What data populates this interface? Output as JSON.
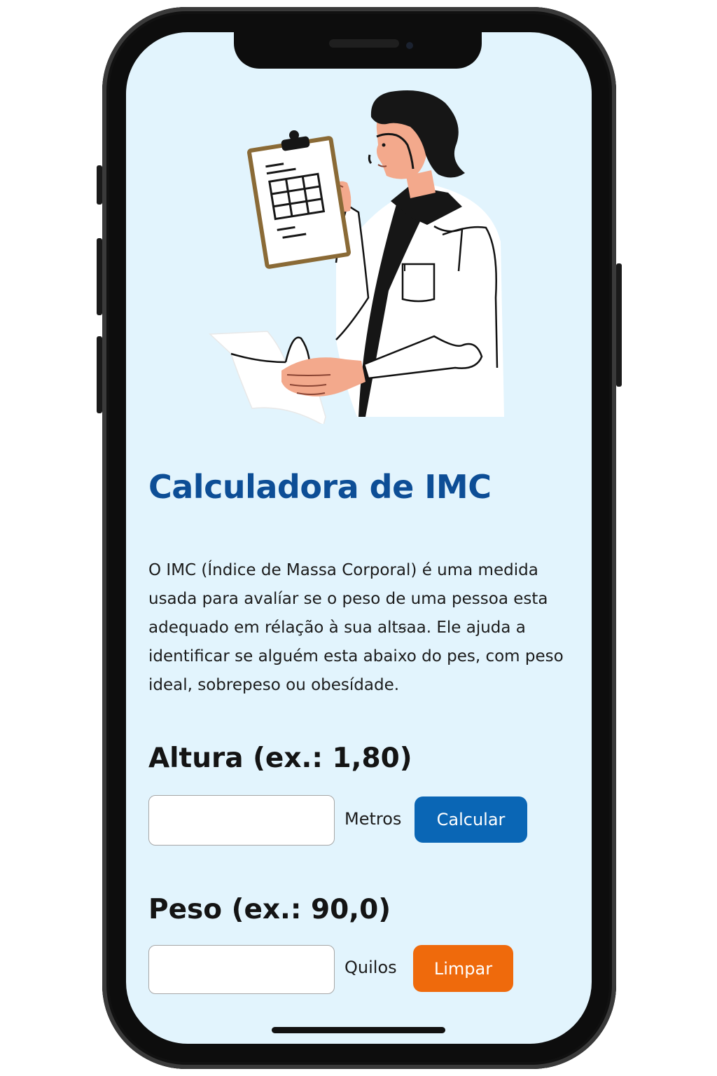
{
  "page": {
    "title": "Calculadora de IMC",
    "description": "O IMC (Índice de Massa Corporal) é uma medida usada para avalíar se o peso de uma pessoa esta adequado em rélação à sua altꞩaa. Ele ajuda a identificar se alguém esta abaixo do pes, com peso ideal, sobrepeso ou obesídade."
  },
  "form": {
    "height": {
      "label": "Altura (ex.: 1,80)",
      "value": "",
      "unit": "Metros",
      "button_label": "Calcular"
    },
    "weight": {
      "label": "Peso (ex.: 90,0)",
      "value": "",
      "unit": "Quilos",
      "button_label": "Limpar"
    }
  },
  "colors": {
    "screen_background": "#e2f4fd",
    "title": "#0d4e96",
    "calculate_button": "#0a66b5",
    "clear_button": "#ef6a0c"
  },
  "illustration": {
    "icon": "doctor-with-clipboard-illustration"
  }
}
